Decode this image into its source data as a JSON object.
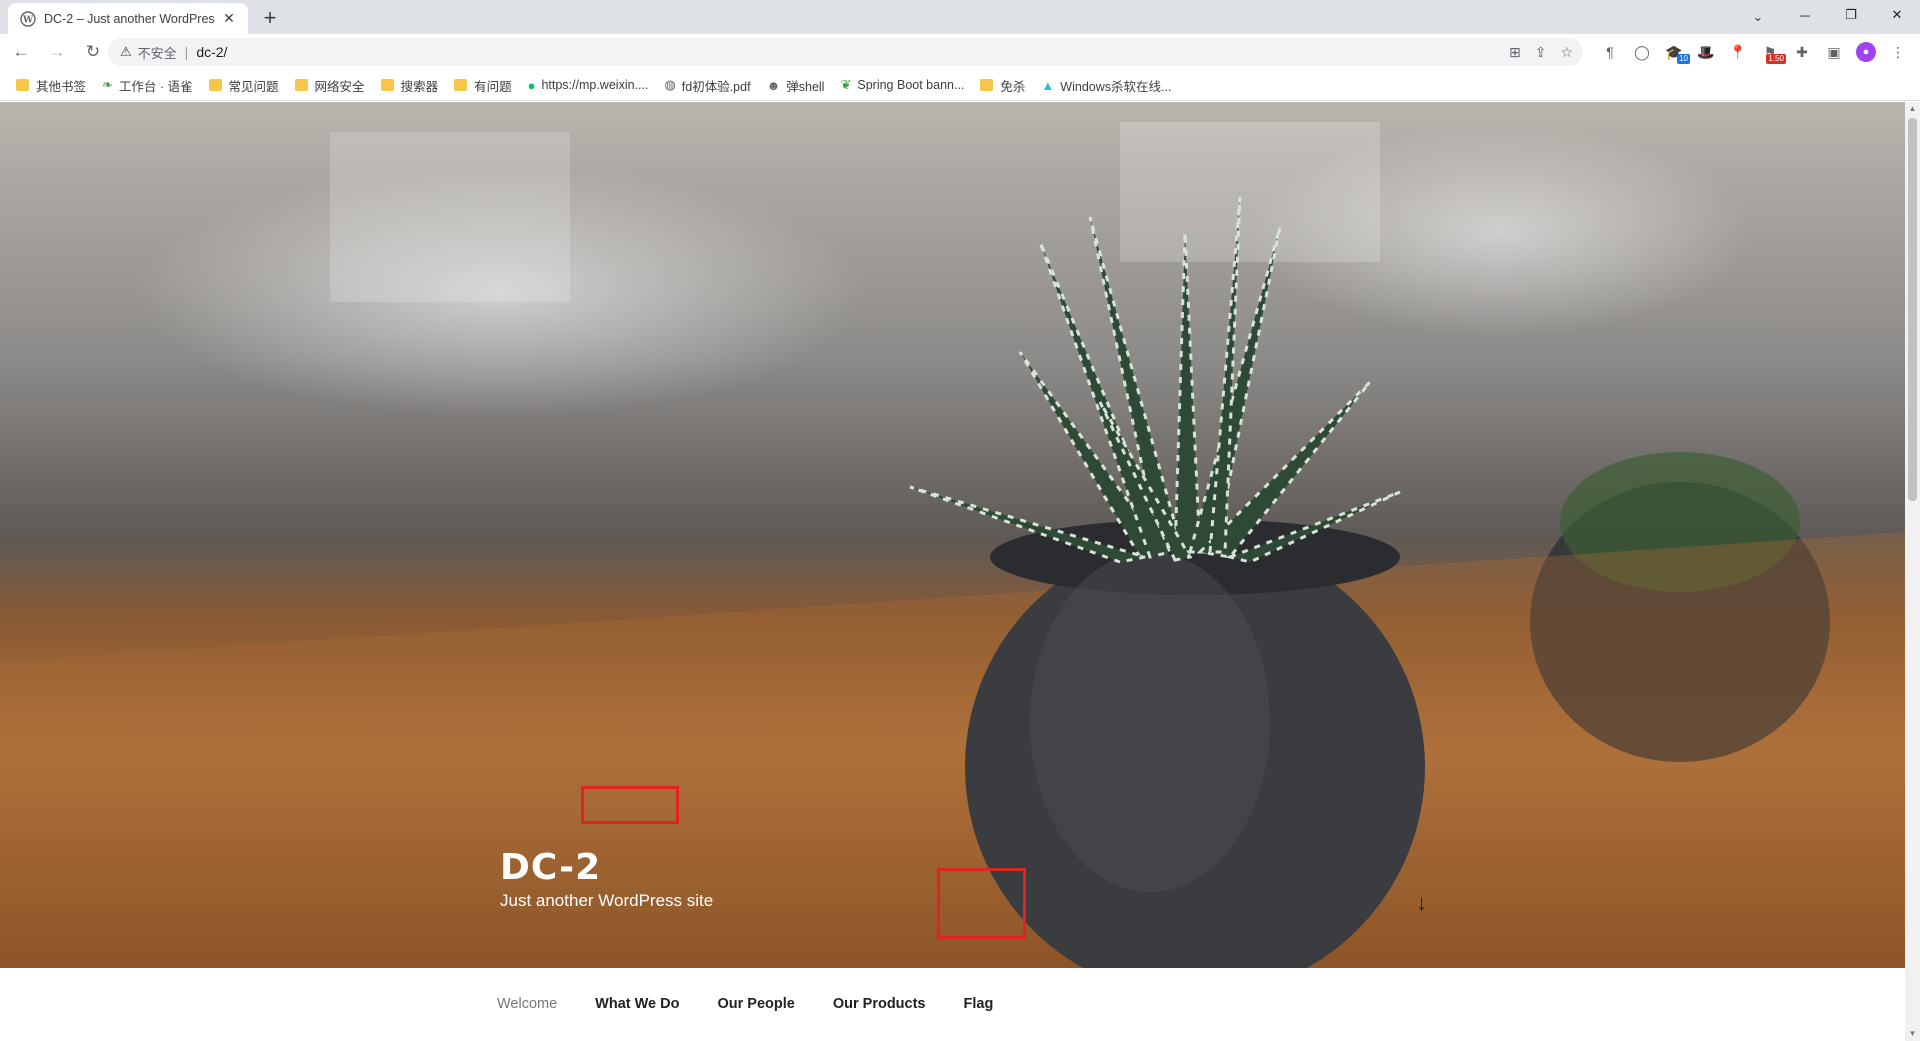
{
  "browser": {
    "tab": {
      "title": "DC-2 – Just another WordPres",
      "close": "✕"
    },
    "new_tab": "+",
    "tab_search": "⌄",
    "window_controls": {
      "minimize": "─",
      "restore": "❐",
      "close": "✕"
    },
    "nav": {
      "back": "←",
      "forward": "→",
      "reload": "↻"
    },
    "address": {
      "warning": "⚠",
      "security_text": "不安全",
      "separator": "|",
      "url": "dc-2/"
    },
    "extensions": [
      {
        "name": "translate-icon",
        "glyph": "⊞"
      },
      {
        "name": "share-icon",
        "glyph": "⇪"
      },
      {
        "name": "bookmark-star-icon",
        "glyph": "☆"
      }
    ],
    "toolbar_extensions": [
      {
        "name": "pilcrow-extension-icon",
        "glyph": "¶",
        "badge": ""
      },
      {
        "name": "circle-extension-icon",
        "glyph": "◯",
        "badge": ""
      },
      {
        "name": "graduation-cap-extension-icon",
        "glyph": "🎓",
        "badge": "10"
      },
      {
        "name": "hat-extension-icon",
        "glyph": "🎩",
        "badge": ""
      },
      {
        "name": "pin-extension-icon",
        "glyph": "📍",
        "badge": ""
      },
      {
        "name": "flag-extension-icon",
        "glyph": "⚑",
        "badge": "1.50"
      },
      {
        "name": "puzzle-extension-icon",
        "glyph": "✚",
        "badge": ""
      },
      {
        "name": "side-panel-icon",
        "glyph": "▣",
        "badge": ""
      }
    ],
    "profile_initial": "●",
    "menu": "⋮",
    "bookmarks": [
      {
        "label": "其他书签",
        "type": "folder"
      },
      {
        "label": "工作台 · 语雀",
        "type": "leaf-green"
      },
      {
        "label": "常见问题",
        "type": "folder"
      },
      {
        "label": "网络安全",
        "type": "folder"
      },
      {
        "label": "搜索器",
        "type": "folder"
      },
      {
        "label": "有问题",
        "type": "folder"
      },
      {
        "label": "https://mp.weixin....",
        "type": "wechat"
      },
      {
        "label": "fd初体验.pdf",
        "type": "globe"
      },
      {
        "label": "弹shell",
        "type": "alien"
      },
      {
        "label": "Spring Boot bann...",
        "type": "leaf-small"
      },
      {
        "label": "免杀",
        "type": "folder"
      },
      {
        "label": "Windows杀软在线...",
        "type": "arrow"
      }
    ]
  },
  "page": {
    "site_title": "DC-2",
    "site_description": "Just another WordPress site",
    "menu": [
      {
        "label": "Welcome",
        "current": true
      },
      {
        "label": "What We Do",
        "current": false
      },
      {
        "label": "Our People",
        "current": false
      },
      {
        "label": "Our Products",
        "current": false
      },
      {
        "label": "Flag",
        "current": false
      }
    ],
    "scroll_down": "↓"
  },
  "colors": {
    "highlight": "#e32222",
    "menu_text": "#222222",
    "menu_current": "#767676"
  }
}
